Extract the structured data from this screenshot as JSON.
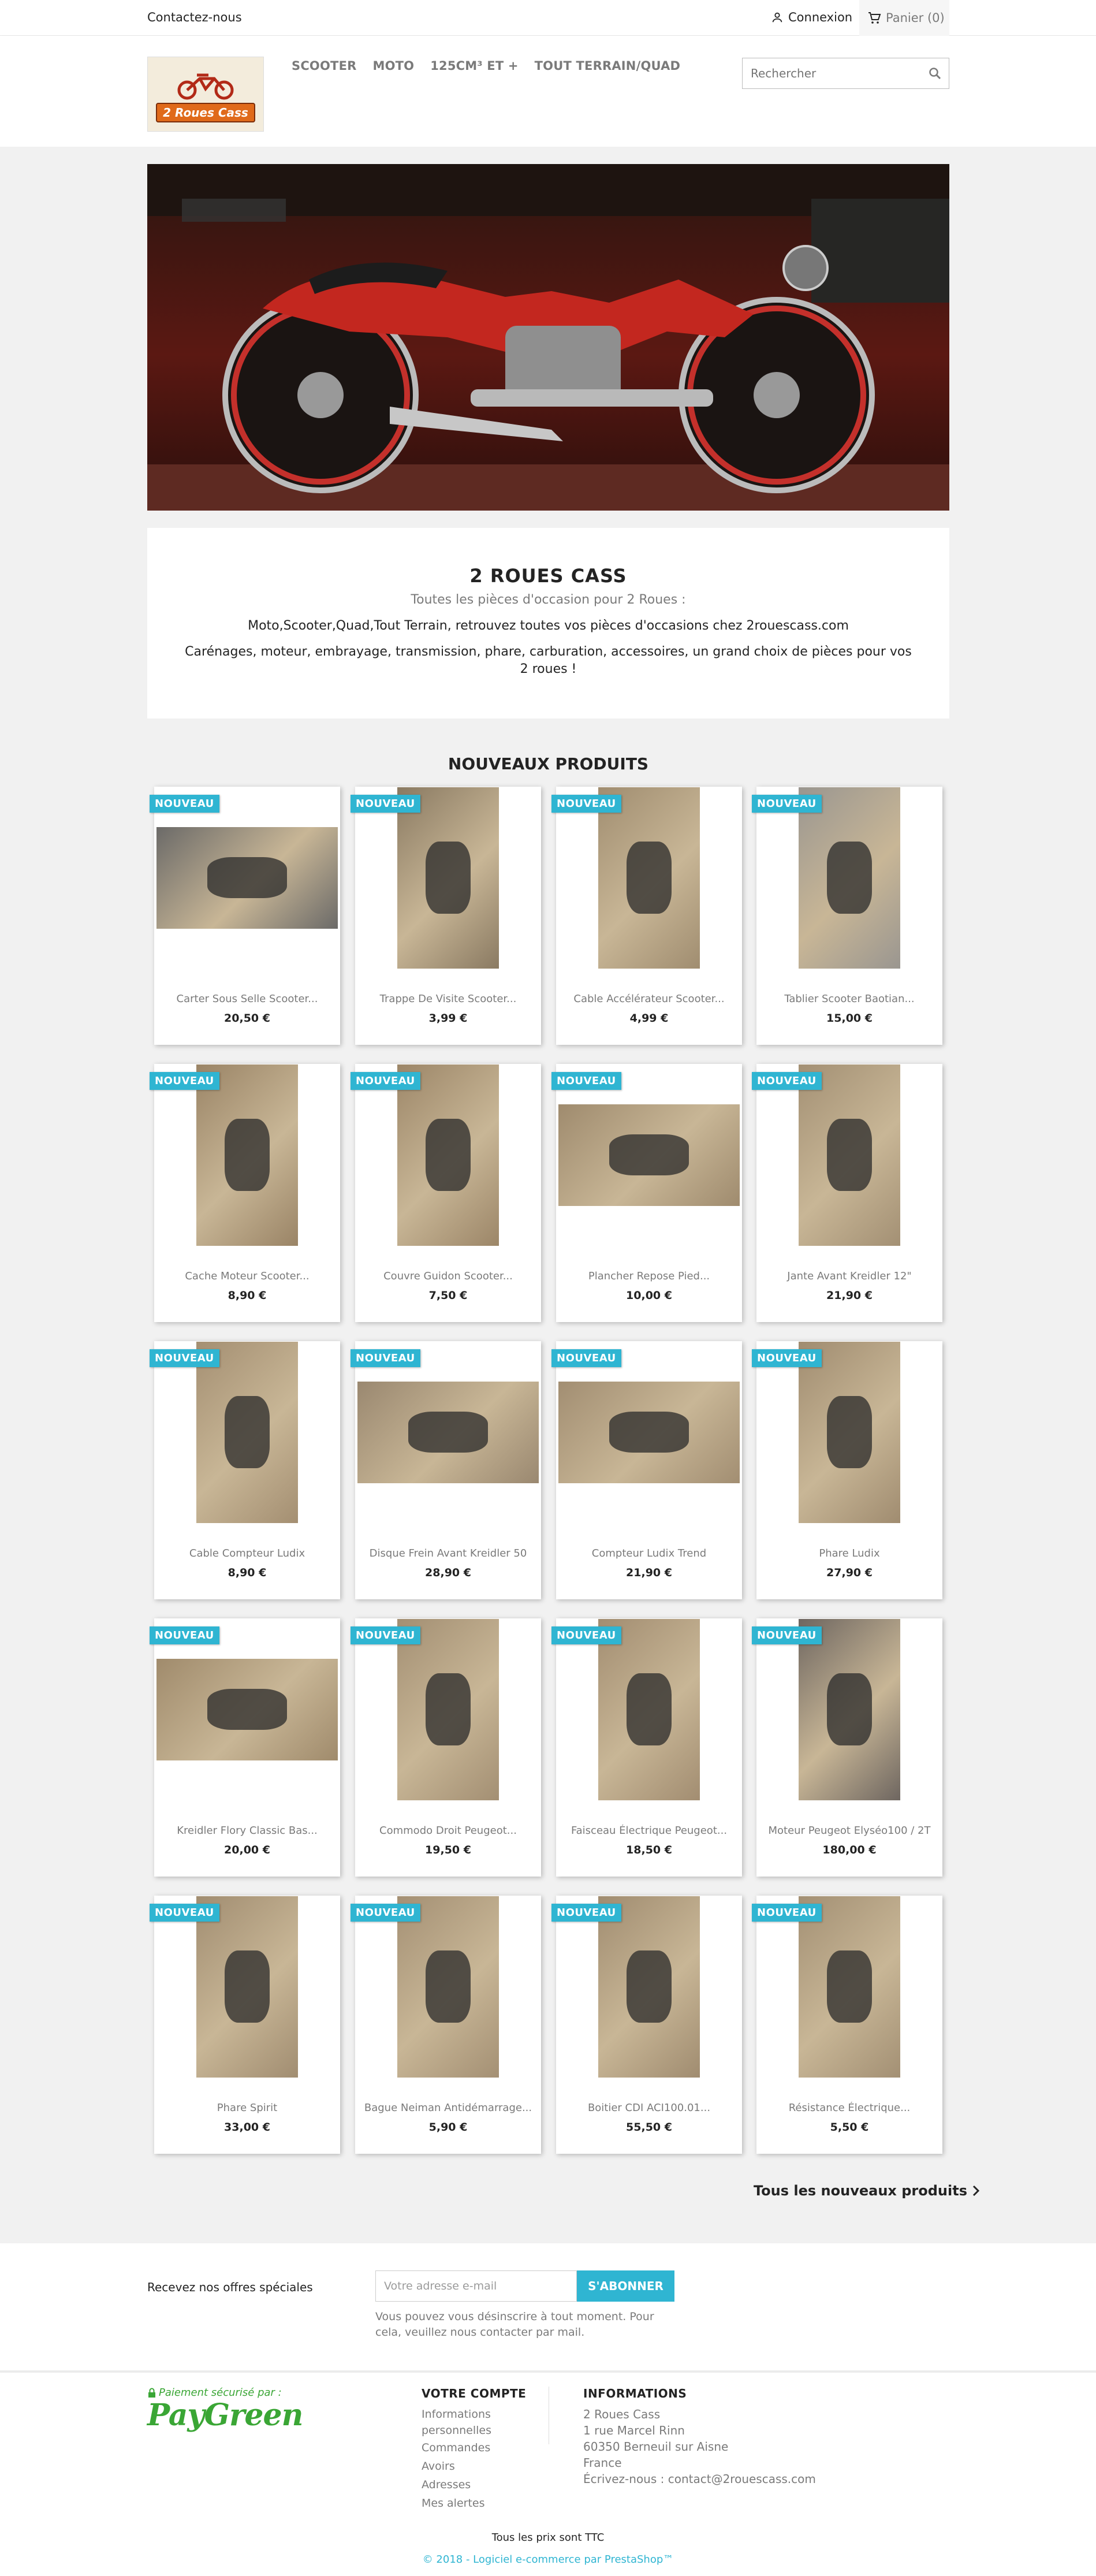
{
  "topbar": {
    "contact": "Contactez-nous",
    "login": "Connexion",
    "cart": "Panier (0)"
  },
  "header": {
    "logo_text": "2 Roues Cass",
    "menu": [
      "SCOOTER",
      "MOTO",
      "125CM³ ET +",
      "TOUT TERRAIN/QUAD"
    ],
    "search_placeholder": "Rechercher"
  },
  "intro": {
    "title": "2 ROUES CASS",
    "subtitle": "Toutes les pièces d'occasion pour 2 Roues :",
    "line1": "Moto,Scooter,Quad,Tout Terrain, retrouvez toutes vos pièces d'occasions chez 2rouescass.com",
    "line2": "Carénages, moteur, embrayage, transmission, phare, carburation, accessoires, un grand choix de pièces pour vos 2 roues !"
  },
  "products_section": {
    "title": "NOUVEAUX PRODUITS",
    "badge": "NOUVEAU",
    "all_link": "Tous les nouveaux produits",
    "items": [
      {
        "name": "Carter Sous Selle Scooter...",
        "price": "20,50 €",
        "shape": "wide",
        "tone": "#6b6a68"
      },
      {
        "name": "Trappe De Visite Scooter...",
        "price": "3,99 €",
        "shape": "tall",
        "tone": "#8a7a62"
      },
      {
        "name": "Cable Accélérateur Scooter...",
        "price": "4,99 €",
        "shape": "tall",
        "tone": "#a08d70"
      },
      {
        "name": "Tablier Scooter Baotian...",
        "price": "15,00 €",
        "shape": "tall",
        "tone": "#9a9690"
      },
      {
        "name": "Cache Moteur Scooter...",
        "price": "8,90 €",
        "shape": "tall",
        "tone": "#9a8466"
      },
      {
        "name": "Couvre Guidon Scooter...",
        "price": "7,50 €",
        "shape": "tall",
        "tone": "#9c8668"
      },
      {
        "name": "Plancher Repose Pied...",
        "price": "10,00 €",
        "shape": "wide",
        "tone": "#9f8b6e"
      },
      {
        "name": "Jante Avant Kreidler 12\"",
        "price": "21,90 €",
        "shape": "tall",
        "tone": "#a39074"
      },
      {
        "name": "Cable Compteur Ludix",
        "price": "8,90 €",
        "shape": "tall",
        "tone": "#a48f72"
      },
      {
        "name": "Disque Frein Avant Kreidler 50",
        "price": "28,90 €",
        "shape": "wide",
        "tone": "#9a8870"
      },
      {
        "name": "Compteur Ludix Trend",
        "price": "21,90 €",
        "shape": "wide",
        "tone": "#a28e72"
      },
      {
        "name": "Phare Ludix",
        "price": "27,90 €",
        "shape": "tall",
        "tone": "#a08c70"
      },
      {
        "name": "Kreidler Flory Classic Bas...",
        "price": "20,00 €",
        "shape": "wide",
        "tone": "#a08b6c"
      },
      {
        "name": "Commodo Droit Peugeot...",
        "price": "19,50 €",
        "shape": "tall",
        "tone": "#a38f73"
      },
      {
        "name": "Faisceau Électrique Peugeot...",
        "price": "18,50 €",
        "shape": "tall",
        "tone": "#a28d71"
      },
      {
        "name": "Moteur Peugeot Elyséo100 / 2T",
        "price": "180,00 €",
        "shape": "tall",
        "tone": "#6e6660"
      },
      {
        "name": "Phare Spirit",
        "price": "33,00 €",
        "shape": "tall",
        "tone": "#a18d71"
      },
      {
        "name": "Bague Neiman Antidémarrage...",
        "price": "5,90 €",
        "shape": "tall",
        "tone": "#a49074"
      },
      {
        "name": "Boitier CDI ACI100.01...",
        "price": "55,50 €",
        "shape": "tall",
        "tone": "#a08c70"
      },
      {
        "name": "Résistance Électrique...",
        "price": "5,50 €",
        "shape": "tall",
        "tone": "#a39074"
      }
    ]
  },
  "newsletter": {
    "label": "Recevez nos offres spéciales",
    "email_placeholder": "Votre adresse e-mail",
    "button": "S'ABONNER",
    "note": "Vous pouvez vous désinscrire à tout moment. Pour cela, veuillez nous contacter par mail."
  },
  "footer": {
    "payment_secure": "Paiement sécurisé par :",
    "payment_brand": "PayGreen",
    "account_title": "VOTRE COMPTE",
    "account_links": [
      "Informations personnelles",
      "Commandes",
      "Avoirs",
      "Adresses",
      "Mes alertes"
    ],
    "info_title": "INFORMATIONS",
    "info_lines": [
      "2 Roues Cass",
      "1 rue Marcel Rinn",
      "60350 Berneuil sur Aisne",
      "France",
      "Écrivez-nous : contact@2rouescass.com"
    ],
    "tax_note": "Tous les prix sont TTC",
    "copyright": "© 2018 - Logiciel e-commerce par PrestaShop™"
  },
  "colors": {
    "accent": "#2fb5d2",
    "text": "#232323",
    "muted": "#7a7a7a",
    "paygreen": "#3aa635"
  }
}
